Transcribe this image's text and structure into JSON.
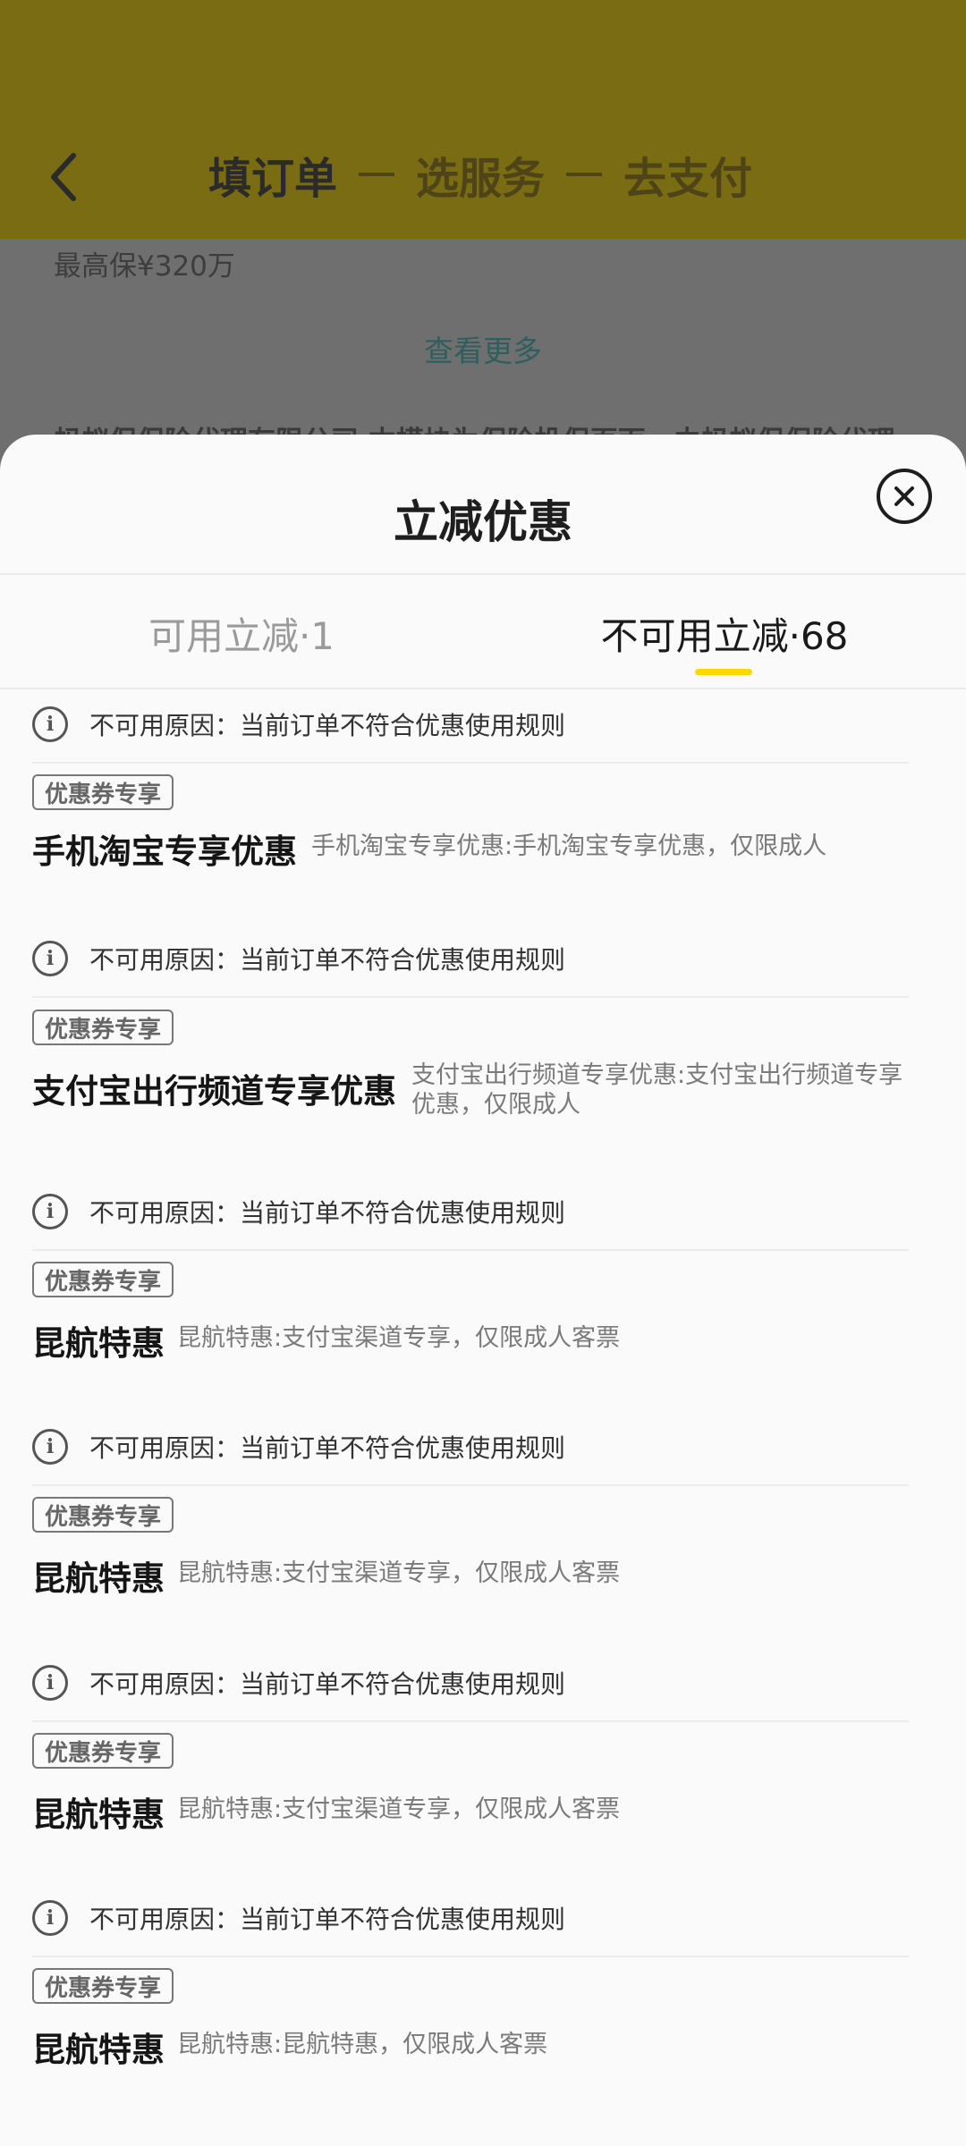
{
  "background": {
    "steps": [
      "填订单",
      "选服务",
      "去支付"
    ],
    "max_cover": "最高保¥320万",
    "see_more": "查看更多",
    "footnote": "蚂蚁保保险代理有限公司 本模块为保险投保页面，由蚂蚁保保险代理"
  },
  "sheet": {
    "title": "立减优惠",
    "tabs": [
      {
        "label": "可用立减·1"
      },
      {
        "label": "不可用立减·68"
      }
    ],
    "active_tab": 1,
    "accent_color": "#ffd800"
  },
  "items": [
    {
      "reason": "不可用原因：当前订单不符合优惠使用规则"
    },
    {
      "badge": "优惠券专享",
      "title": "手机淘宝专享优惠",
      "desc": "手机淘宝专享优惠:手机淘宝专享优惠，仅限成人",
      "reason": "不可用原因：当前订单不符合优惠使用规则"
    },
    {
      "badge": "优惠券专享",
      "title": "支付宝出行频道专享优惠",
      "desc": "支付宝出行频道专享优惠:支付宝出行频道专享优惠，仅限成人",
      "reason": "不可用原因：当前订单不符合优惠使用规则"
    },
    {
      "badge": "优惠券专享",
      "title": "昆航特惠",
      "desc": "昆航特惠:支付宝渠道专享，仅限成人客票",
      "reason": "不可用原因：当前订单不符合优惠使用规则"
    },
    {
      "badge": "优惠券专享",
      "title": "昆航特惠",
      "desc": "昆航特惠:支付宝渠道专享，仅限成人客票",
      "reason": "不可用原因：当前订单不符合优惠使用规则"
    },
    {
      "badge": "优惠券专享",
      "title": "昆航特惠",
      "desc": "昆航特惠:支付宝渠道专享，仅限成人客票",
      "reason": "不可用原因：当前订单不符合优惠使用规则"
    },
    {
      "badge": "优惠券专享",
      "title": "昆航特惠",
      "desc": "昆航特惠:昆航特惠，仅限成人客票"
    }
  ],
  "icons": {
    "back": "chevron-left-icon",
    "close": "close-circle-icon",
    "info": "info-icon"
  }
}
